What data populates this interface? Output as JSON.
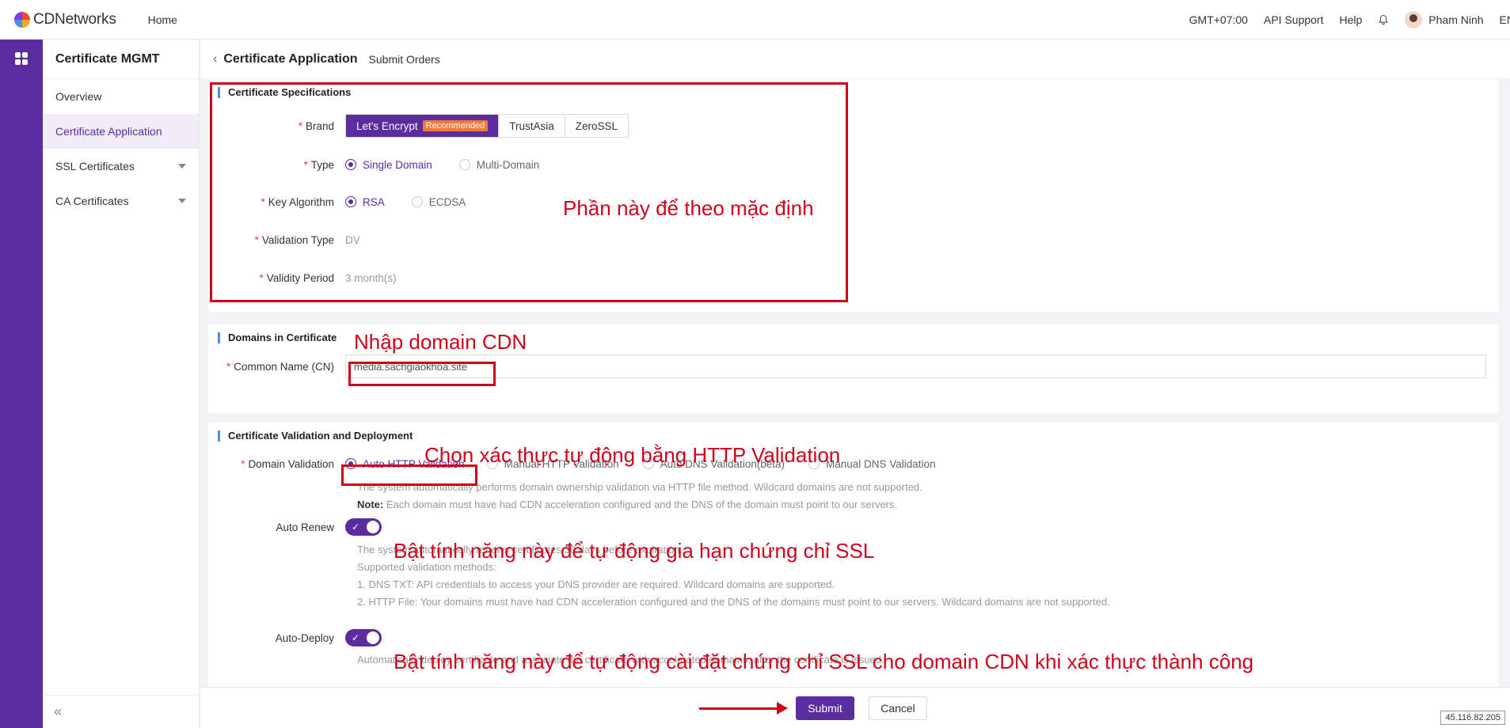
{
  "topbar": {
    "logo_text": "CDNetworks",
    "home": "Home",
    "timezone": "GMT+07:00",
    "api_support": "API Support",
    "help": "Help",
    "user_name": "Pham Ninh",
    "language": "EN"
  },
  "sidebar": {
    "title": "Certificate MGMT",
    "items": [
      {
        "label": "Overview"
      },
      {
        "label": "Certificate Application"
      },
      {
        "label": "SSL Certificates"
      },
      {
        "label": "CA Certificates"
      }
    ],
    "collapse": "«"
  },
  "header": {
    "title": "Certificate Application",
    "subtitle": "Submit Orders"
  },
  "specs": {
    "section_title": "Certificate Specifications",
    "brand_label": "Brand",
    "brands": [
      "Let's Encrypt",
      "TrustAsia",
      "ZeroSSL"
    ],
    "recommended": "Recommended",
    "type_label": "Type",
    "type_options": [
      "Single Domain",
      "Multi-Domain"
    ],
    "key_label": "Key Algorithm",
    "key_options": [
      "RSA",
      "ECDSA"
    ],
    "validation_type_label": "Validation Type",
    "validation_type_value": "DV",
    "validity_label": "Validity Period",
    "validity_value": "3 month(s)"
  },
  "domains": {
    "section_title": "Domains in Certificate",
    "cn_label": "Common Name (CN)",
    "cn_value": "media.sachgiaokhoa.site"
  },
  "validation": {
    "section_title": "Certificate Validation and Deployment",
    "domain_validation_label": "Domain Validation",
    "options": [
      "Auto HTTP Validation",
      "Manual HTTP Validation",
      "Auto DNS Validation(beta)",
      "Manual DNS Validation"
    ],
    "desc1": "The system automatically performs domain ownership validation via HTTP file method. Wildcard domains are not supported.",
    "note_label": "Note:",
    "note_text": " Each domain must have had CDN acceleration configured and the DNS of the domain must point to our servers.",
    "auto_renew_label": "Auto Renew",
    "renew_lines": [
      "The system automatically renews certificates 30 days before expiration.",
      "Supported validation methods:",
      "1. DNS TXT: API credentials to access your DNS provider are required. Wildcard domains are supported.",
      "2. HTTP File: Your domains must have had CDN acceleration configured and the DNS of the domains must point to our servers. Wildcard domains are not supported."
    ],
    "auto_deploy_label": "Auto-Deploy",
    "deploy_desc": "Automatically deploy certificate and associate the certificate with accelerated domains, after the certificate is issued."
  },
  "annotations": {
    "default_note": "Phần này để theo mặc định",
    "domain_note": "Nhập domain CDN",
    "validation_note": "Chọn xác thực tự động bằng HTTP Validation",
    "renew_note": "Bật tính năng này để tự động gia hạn chứng chỉ SSL",
    "deploy_note": "Bật tính năng này để tự động cài đặt chứng chỉ SSL cho domain CDN khi xác thực thành công"
  },
  "footer": {
    "submit": "Submit",
    "cancel": "Cancel"
  },
  "ip_address": "45.116.82.205",
  "colors": {
    "brand": "#5b2ca0",
    "annotation": "#d0021b",
    "accent_bar": "#4a90e2"
  }
}
